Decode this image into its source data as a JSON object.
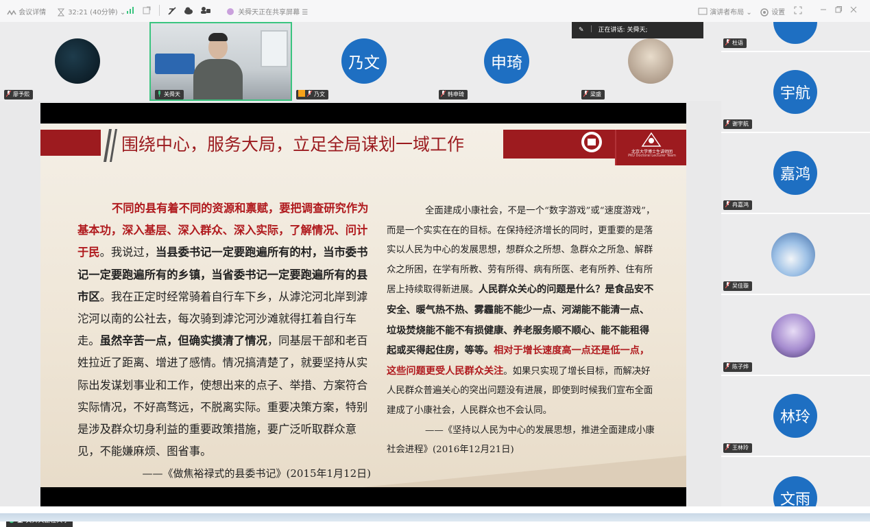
{
  "topbar": {
    "meeting_details": "会议详情",
    "timer": "32:21 (40分钟)",
    "sharing_notice": "关舜天正在共享屏幕",
    "presenter_layout": "演讲者布局",
    "settings": "设置"
  },
  "participants_top": [
    {
      "name": "廖予熙",
      "avatar_text": "",
      "avatar_color": "#0d2330"
    },
    {
      "name": "关舜天",
      "avatar_text": "",
      "avatar_color": "#8a8f94"
    },
    {
      "name": "乃文",
      "avatar_text": "乃文",
      "avatar_color": "#1e6fc2"
    },
    {
      "name": "韩申琦",
      "avatar_text": "申琦",
      "avatar_color": "#1e6fc2"
    },
    {
      "name": "梁盛",
      "avatar_text": "",
      "avatar_color": "#b9a28c"
    }
  ],
  "active_speaker": {
    "label": "正在讲话:",
    "name": "关舜天;"
  },
  "participants_right": [
    {
      "name": "杜语",
      "avatar_text": "",
      "avatar_color": "#1e6fc2"
    },
    {
      "name": "谢宇航",
      "avatar_text": "宇航",
      "avatar_color": "#1e6fc2"
    },
    {
      "name": "冉嘉鸿",
      "avatar_text": "嘉鸿",
      "avatar_color": "#1e6fc2"
    },
    {
      "name": "吴佳璇",
      "avatar_text": "",
      "avatar_color": "#7fa8d6"
    },
    {
      "name": "陈子烨",
      "avatar_text": "",
      "avatar_color": "#a58bcf"
    },
    {
      "name": "王林玲",
      "avatar_text": "林玲",
      "avatar_color": "#1e6fc2"
    },
    {
      "name": "",
      "avatar_text": "文雨",
      "avatar_color": "#1e6fc2"
    }
  ],
  "slide": {
    "title": "围绕中心，服务大局，立足全局谋划一域工作",
    "logo_text": "北京大学博士生讲师团",
    "logo_subtext": "PKU Doctoral Lecturer Team",
    "left": {
      "p1": "不同的县有着不同的资源和禀赋，要把调查研究作为基本功，深入基层、深入群众、深入实际，了解情况、问计于民",
      "p2": "。我说过，",
      "p3": "当县委书记一定要跑遍所有的村，当市委书记一定要跑遍所有的乡镇，当省委书记一定要跑遍所有的县市区",
      "p4": "。我在正定时经常骑着自行车下乡，从滹沱河北岸到滹沱河以南的公社去，每次骑到滹沱河沙滩就得扛着自行车走。",
      "p5": "虽然辛苦一点，但确实摸清了情况",
      "p6": "，同基层干部和老百姓拉近了距离、增进了感情。情况搞清楚了，就要坚持从实际出发谋划事业和工作，使想出来的点子、举措、方案符合实际情况，不好高骛远，不脱离实际。重要决策方案，特别是涉及群众切身利益的重要政策措施，要广泛听取群众意见，不能嫌麻烦、图省事。",
      "cite": "——《做焦裕禄式的县委书记》(2015年1月12日)"
    },
    "right": {
      "p1": "全面建成小康社会，不是一个“数字游戏”或“速度游戏”，而是一个实实在在的目标。在保持经济增长的同时，更重要的是落实以人民为中心的发展思想，想群众之所想、急群众之所急、解群众之所困，在学有所教、劳有所得、病有所医、老有所养、住有所居上持续取得新进展。",
      "p2": "人民群众关心的问题是什么？是食品安不安全、暖气热不热、雾霾能不能少一点、河湖能不能清一点、垃圾焚烧能不能不有损健康、养老服务顺不顺心、能不能租得起或买得起住房，等等。",
      "p3": "相对于增长速度高一点还是低一点，这些问题更受人民群众关注",
      "p4": "。如果只实现了增长目标，而解决好人民群众普遍关心的突出问题没有进展，即使到时候我们宣布全面建成了小康社会，人民群众也不会认同。",
      "cite": "——《坚持以人民为中心的发展思想，推进全面建成小康社会进程》(2016年12月21日)"
    }
  },
  "share_tag": "关舜天正在共享",
  "colors": {
    "slide_red": "#9d1b1f",
    "avatar_blue": "#1e6fc2",
    "video_border": "#3ac47f"
  }
}
